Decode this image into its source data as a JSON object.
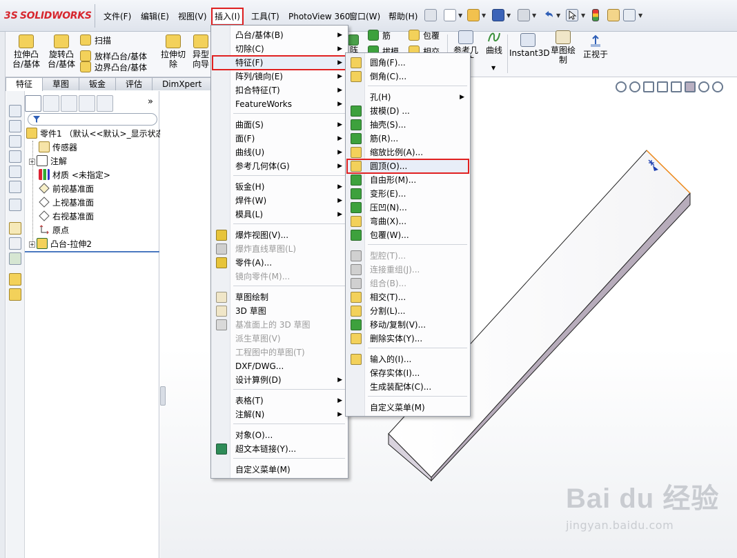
{
  "app": {
    "logo_mark": "3S",
    "logo_text": "SOLIDWORKS"
  },
  "menubar": {
    "items": [
      "文件(F)",
      "编辑(E)",
      "视图(V)",
      "插入(I)",
      "工具(T)",
      "PhotoView 360",
      "窗口(W)",
      "帮助(H)"
    ]
  },
  "ribbon": {
    "extrude_boss": "拉伸凸\n台/基体",
    "revolve_boss": "旋转凸\n台/基体",
    "sweep": "扫描",
    "loft": "放样凸台/基体",
    "boundary": "边界凸台/基体",
    "extrude_cut": "拉伸切\n除",
    "hole_wizard": "异型\n向导",
    "pattern": "阵",
    "rib": "筋",
    "wrap": "包覆",
    "draft": "拔模",
    "intersect": "相交",
    "ref_geometry": "参考几\n何体",
    "curves": "曲线",
    "instant3d": "Instant3D",
    "sketch": "草图绘\n制",
    "normal_to": "正视于"
  },
  "tabs": [
    "特征",
    "草图",
    "钣金",
    "评估",
    "DimXpert"
  ],
  "tree": {
    "root": "零件1 （默认<<默认>_显示状态",
    "items": [
      "传感器",
      "注解",
      "材质 <未指定>",
      "前视基准面",
      "上视基准面",
      "右视基准面",
      "原点",
      "凸台-拉伸2"
    ]
  },
  "insert_menu": {
    "items": [
      {
        "label": "凸台/基体(B)",
        "sub": true
      },
      {
        "label": "切除(C)",
        "sub": true
      },
      {
        "label": "特征(F)",
        "sub": true,
        "highlight": true
      },
      {
        "label": "阵列/镜向(E)",
        "sub": true
      },
      {
        "label": "扣合特征(T)",
        "sub": true
      },
      {
        "label": "FeatureWorks",
        "sub": true
      },
      {
        "label": "曲面(S)",
        "sub": true
      },
      {
        "label": "面(F)",
        "sub": true
      },
      {
        "label": "曲线(U)",
        "sub": true
      },
      {
        "label": "参考几何体(G)",
        "sub": true
      },
      {
        "label": "钣金(H)",
        "sub": true
      },
      {
        "label": "焊件(W)",
        "sub": true
      },
      {
        "label": "模具(L)",
        "sub": true
      },
      {
        "label": "爆炸视图(V)..."
      },
      {
        "label": "爆炸直线草图(L)",
        "disabled": true
      },
      {
        "label": "零件(A)..."
      },
      {
        "label": "镜向零件(M)...",
        "disabled": true
      },
      {
        "label": "草图绘制"
      },
      {
        "label": "3D 草图"
      },
      {
        "label": "基准面上的 3D 草图",
        "disabled": true
      },
      {
        "label": "派生草图(V)",
        "disabled": true
      },
      {
        "label": "工程图中的草图(T)",
        "disabled": true
      },
      {
        "label": "DXF/DWG..."
      },
      {
        "label": "设计算例(D)",
        "sub": true
      },
      {
        "label": "表格(T)",
        "sub": true
      },
      {
        "label": "注解(N)",
        "sub": true
      },
      {
        "label": "对象(O)..."
      },
      {
        "label": "超文本链接(Y)..."
      },
      {
        "label": "自定义菜单(M)"
      }
    ]
  },
  "features_menu": {
    "items": [
      {
        "label": "圆角(F)..."
      },
      {
        "label": "倒角(C)..."
      },
      {
        "label": "孔(H)",
        "sub": true
      },
      {
        "label": "拔模(D) ..."
      },
      {
        "label": "抽壳(S)..."
      },
      {
        "label": "筋(R)..."
      },
      {
        "label": "缩放比例(A)..."
      },
      {
        "label": "圆顶(O)...",
        "highlight": true
      },
      {
        "label": "自由形(M)..."
      },
      {
        "label": "变形(E)..."
      },
      {
        "label": "压凹(N)..."
      },
      {
        "label": "弯曲(X)..."
      },
      {
        "label": "包覆(W)..."
      },
      {
        "label": "型腔(T)...",
        "disabled": true
      },
      {
        "label": "连接重组(J)...",
        "disabled": true
      },
      {
        "label": "组合(B)...",
        "disabled": true
      },
      {
        "label": "相交(T)..."
      },
      {
        "label": "分割(L)..."
      },
      {
        "label": "移动/复制(V)..."
      },
      {
        "label": "删除实体(Y)..."
      },
      {
        "label": "输入的(I)..."
      },
      {
        "label": "保存实体(I)..."
      },
      {
        "label": "生成装配体(C)..."
      },
      {
        "label": "自定义菜单(M)"
      }
    ]
  },
  "watermark": {
    "brand": "Bai du 经验",
    "url": "jingyan.baidu.com"
  }
}
